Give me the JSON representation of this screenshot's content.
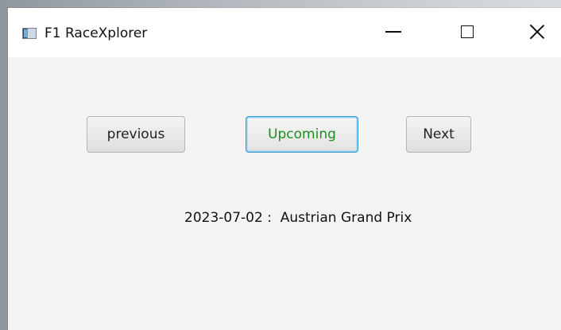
{
  "window": {
    "title": "F1 RaceXplorer",
    "icon": "app-window-icon",
    "controls": {
      "minimize_icon": "minimize-icon",
      "maximize_icon": "maximize-icon",
      "close_icon": "close-icon"
    }
  },
  "navigation": {
    "previous_label": "previous",
    "upcoming_label": "Upcoming",
    "next_label": "Next"
  },
  "race": {
    "date": "2023-07-02",
    "separator": " :  ",
    "name": "Austrian Grand Prix"
  },
  "colors": {
    "upcoming_text": "#1b8f1b",
    "focus_border": "#3a9bd6",
    "window_bg": "#f4f4f4",
    "titlebar_bg": "#ffffff"
  }
}
